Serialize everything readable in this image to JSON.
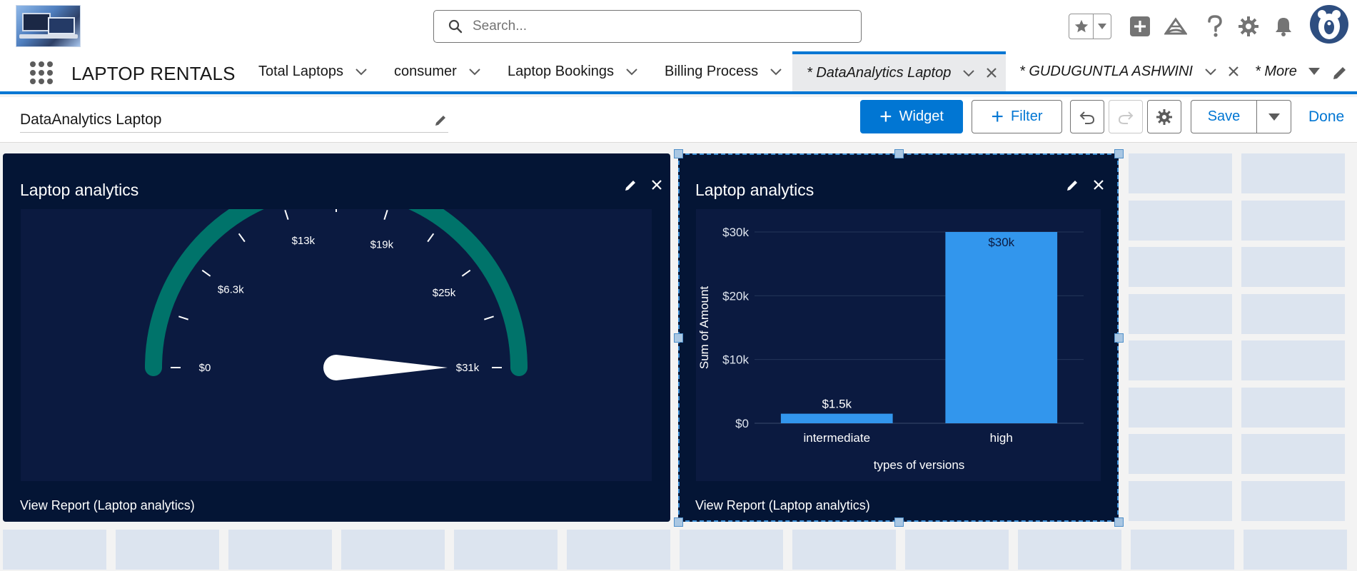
{
  "header": {
    "search_placeholder": "Search...",
    "icons": [
      "favorites-star-icon",
      "favorites-menu-icon",
      "global-actions-plus-icon",
      "trailhead-icon",
      "help-icon",
      "setup-gear-icon",
      "notifications-bell-icon",
      "avatar-icon"
    ]
  },
  "nav": {
    "app_name": "LAPTOP RENTALS",
    "tabs": [
      {
        "label": "Total Laptops"
      },
      {
        "label": "consumer"
      },
      {
        "label": "Laptop Bookings"
      },
      {
        "label": "Billing Process"
      },
      {
        "label": "* DataAnalytics Laptop",
        "active": true
      },
      {
        "label": "* GUDUGUNTLA ASHWINI"
      },
      {
        "label": "* More"
      }
    ]
  },
  "toolbar": {
    "dashboard_title": "DataAnalytics Laptop",
    "widget_label": "Widget",
    "filter_label": "Filter",
    "save_label": "Save",
    "done_label": "Done"
  },
  "widgets": [
    {
      "title": "Laptop analytics",
      "footer": "View Report (Laptop analytics)"
    },
    {
      "title": "Laptop analytics",
      "footer": "View Report (Laptop analytics)"
    }
  ],
  "colors": {
    "brand": "#0176d3",
    "widget_bg": "#041535",
    "gauge_band": "#00736a",
    "bar": "#3296ed"
  },
  "chart_data": [
    {
      "type": "gauge",
      "min": 0,
      "max": 31000,
      "value": 31000,
      "tick_labels": [
        "$0",
        "$6.3k",
        "$13k",
        "$19k",
        "$25k",
        "$31k"
      ],
      "tick_values": [
        0,
        6300,
        13000,
        19000,
        25000,
        31000
      ]
    },
    {
      "type": "bar",
      "categories": [
        "intermediate",
        "high"
      ],
      "values": [
        1500,
        30000
      ],
      "data_labels": [
        "$1.5k",
        "$30k"
      ],
      "xlabel": "types of versions",
      "ylabel": "Sum of Amount",
      "ylim": [
        0,
        30000
      ],
      "y_ticks": [
        0,
        10000,
        20000,
        30000
      ],
      "y_tick_labels": [
        "$0",
        "$10k",
        "$20k",
        "$30k"
      ],
      "grid": true
    }
  ]
}
